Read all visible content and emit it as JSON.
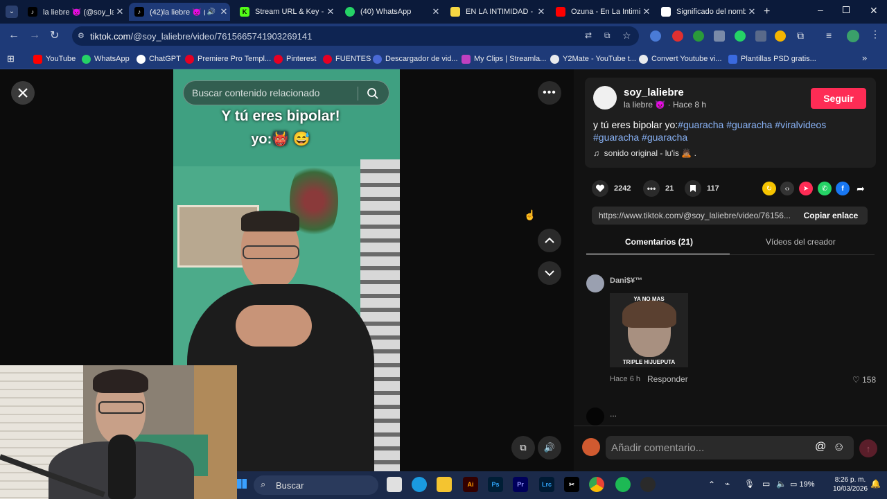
{
  "browser": {
    "tabs": [
      {
        "title": "la liebre 👿 (@soy_la",
        "color": "#000000"
      },
      {
        "title": "(42)la liebre 👿 (@",
        "color": "#000000"
      },
      {
        "title": "Stream URL & Key - k",
        "color": "#53fc18"
      },
      {
        "title": "(40) WhatsApp",
        "color": "#25d366"
      },
      {
        "title": "EN LA INTIMIDAD - C",
        "color": "#f6d743"
      },
      {
        "title": "Ozuna - En La Intimi",
        "color": "#ff0000"
      },
      {
        "title": "Significado del nomb",
        "color": "#ffffff"
      }
    ],
    "url_domain": "tiktok.com",
    "url_path": "/@soy_laliebre/video/7615665741903269141",
    "bookmarks": [
      "YouTube",
      "WhatsApp",
      "ChatGPT",
      "Premiere Pro Templ...",
      "Pinterest",
      "FUENTES",
      "Descargador de vid...",
      "My Clips | Streamla...",
      "Y2Mate - YouTube t...",
      "Convert Youtube vi...",
      "Plantillas PSD gratis..."
    ]
  },
  "video": {
    "search_placeholder": "Buscar contenido relacionado",
    "caption_line1": "Y tú eres bipolar!",
    "caption_line2": "yo:👹 😅"
  },
  "author": {
    "handle": "soy_laliebre",
    "display_name": "la liebre 👿",
    "time_ago": "Hace 8 h",
    "follow_label": "Seguir",
    "description_text": "y tú eres bipolar yo:",
    "hashtags": "#guaracha #guaracha #viralvideos #guaracha #guaracha",
    "sound": "sonido original - lu'is 🙇🏽 ."
  },
  "stats": {
    "likes": "2242",
    "comments": "21",
    "saves": "117"
  },
  "link": {
    "url": "https://www.tiktok.com/@soy_laliebre/video/76156...",
    "copy_label": "Copiar enlace"
  },
  "panel_tabs": {
    "comments": "Comentarios (21)",
    "creator_videos": "Vídeos del creador"
  },
  "comment": {
    "user": "Dani$¥™",
    "meme_top": "YA NO MAS",
    "meme_bottom": "TRIPLE HIJUEPUTA",
    "time": "Hace 6 h",
    "reply_label": "Responder",
    "likes": "158",
    "next_preview": "..."
  },
  "composer": {
    "placeholder": "Añadir comentario..."
  },
  "taskbar": {
    "search_label": "Buscar",
    "battery": "19%",
    "time": "8:26 p. m.",
    "date": "10/03/2026"
  }
}
